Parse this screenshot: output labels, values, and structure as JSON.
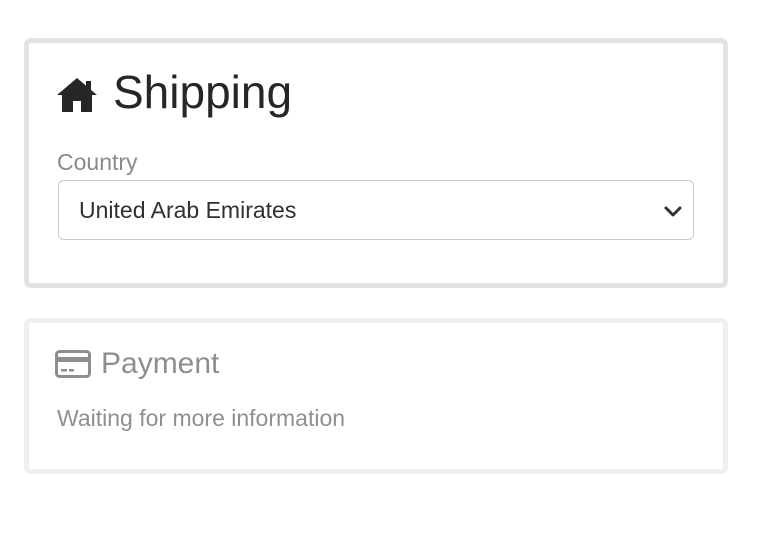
{
  "shipping": {
    "title": "Shipping",
    "icon": "home-icon",
    "country_label": "Country",
    "country_selected": "United Arab Emirates"
  },
  "payment": {
    "title": "Payment",
    "icon": "credit-card-icon",
    "status": "Waiting for more information"
  },
  "colors": {
    "active_border": "#e3e3e3",
    "inactive_border": "#efefef",
    "active_text": "#262626",
    "muted_text": "#8e8e8e"
  }
}
